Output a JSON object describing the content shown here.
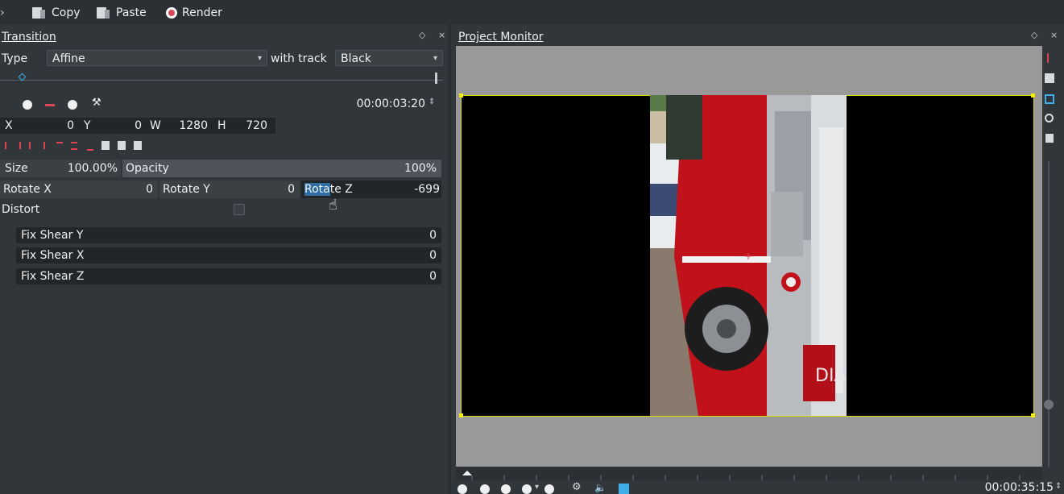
{
  "toolbar": {
    "copy": "Copy",
    "paste": "Paste",
    "render": "Render"
  },
  "transition": {
    "title": "Transition",
    "dock_controls": "◇ ×",
    "type_label": "Type",
    "type_value": "Affine",
    "with_track_label": "with track",
    "track_value": "Black",
    "timecode": "00:00:03:20",
    "x_label": "X",
    "x_value": "0",
    "y_label": "Y",
    "y_value": "0",
    "w_label": "W",
    "w_value": "1280",
    "h_label": "H",
    "h_value": "720",
    "size_label": "Size",
    "size_value": "100.00%",
    "opacity_label": "Opacity",
    "opacity_value": "100%",
    "rotate_x_label": "Rotate X",
    "rotate_x_value": "0",
    "rotate_y_label": "Rotate Y",
    "rotate_y_value": "0",
    "rotate_z_label_sel": "Rota",
    "rotate_z_label_rest": "te Z",
    "rotate_z_value": "-699",
    "distort_label": "Distort",
    "shear": [
      {
        "label": "Fix Shear Y",
        "value": "0"
      },
      {
        "label": "Fix Shear X",
        "value": "0"
      },
      {
        "label": "Fix Shear Z",
        "value": "0"
      }
    ]
  },
  "monitor": {
    "title": "Project Monitor",
    "dock_controls": "◇ ×",
    "timecode": "00:00:35:15"
  },
  "colors": {
    "accent": "#3daee9",
    "selection": "#2f6ea5",
    "frame_border": "#d9d900",
    "record": "#da4453"
  }
}
